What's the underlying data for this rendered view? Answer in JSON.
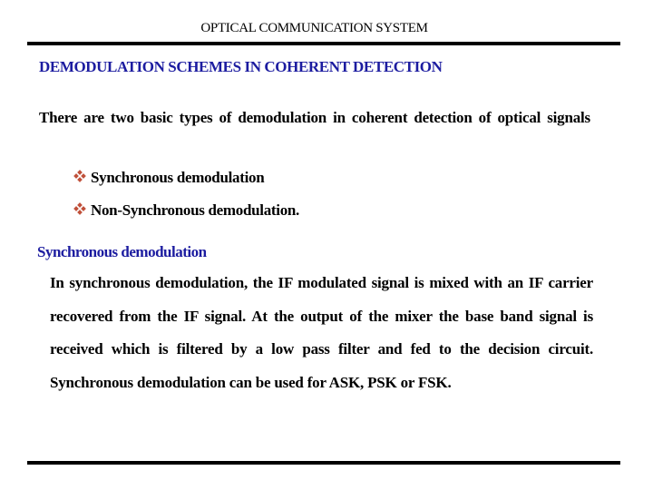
{
  "header": {
    "title": "OPTICAL COMMUNICATION SYSTEM"
  },
  "slide": {
    "heading": "DEMODULATION SCHEMES IN COHERENT DETECTION",
    "intro": "There are two basic types of demodulation in coherent detection of optical signals",
    "bullet_icon": "diamond-cluster-icon",
    "bullets": [
      "Synchronous demodulation",
      "Non-Synchronous demodulation."
    ],
    "subheading": "Synchronous demodulation",
    "body": "In synchronous demodulation, the IF modulated signal is mixed with an IF carrier recovered from the IF signal. At the output of the mixer the base band signal is received which is filtered by a low pass filter and fed to the decision circuit. Synchronous demodulation can be used for ASK, PSK or FSK."
  },
  "colors": {
    "heading": "#1c1ca0",
    "bullet": "#c0503a",
    "text": "#000000",
    "rule": "#000000"
  }
}
